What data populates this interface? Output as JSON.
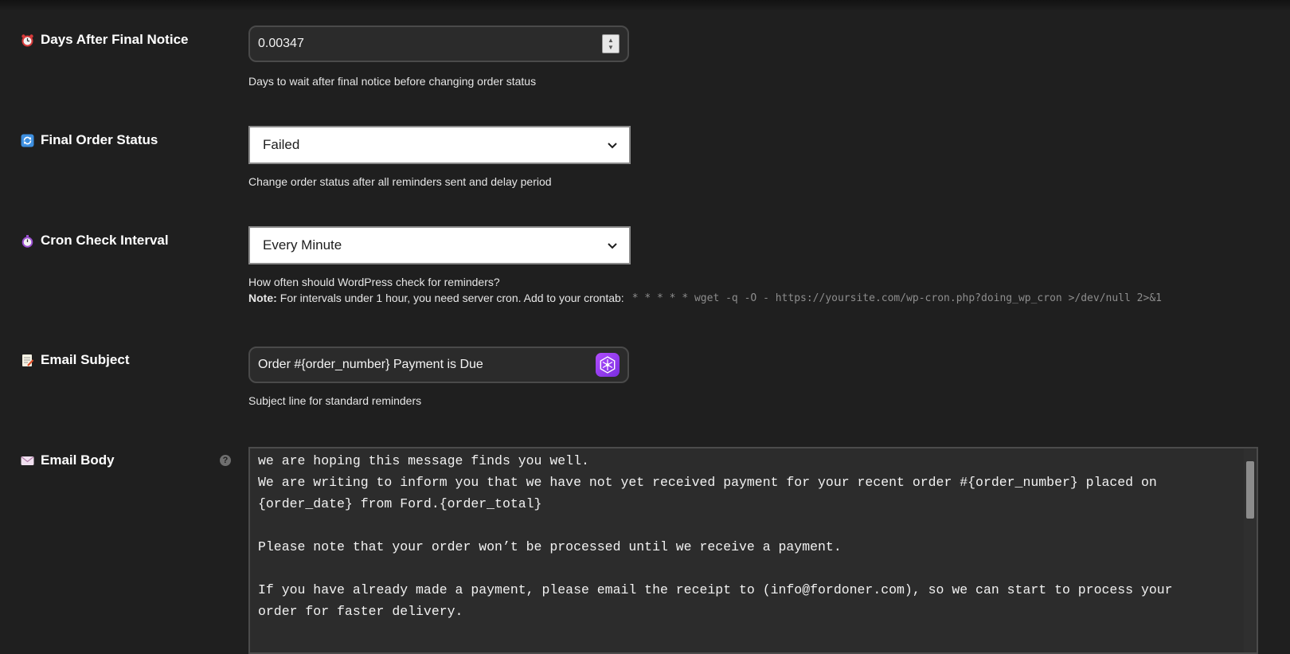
{
  "days_after_final_notice": {
    "label": "Days After Final Notice",
    "value": "0.00347",
    "description": "Days to wait after final notice before changing order status",
    "icon": "alarm-clock-icon"
  },
  "final_order_status": {
    "label": "Final Order Status",
    "selected": "Failed",
    "description": "Change order status after all reminders sent and delay period",
    "icon": "refresh-icon"
  },
  "cron_check_interval": {
    "label": "Cron Check Interval",
    "selected": "Every Minute",
    "description": "How often should WordPress check for reminders?",
    "note_label": "Note:",
    "note_text": "For intervals under 1 hour, you need server cron. Add to your crontab:",
    "cron_command": "* * * * * wget -q -O - https://yoursite.com/wp-cron.php?doing_wp_cron >/dev/null 2>&1",
    "icon": "stopwatch-icon"
  },
  "email_subject": {
    "label": "Email Subject",
    "value": "Order #{order_number} Payment is Due",
    "description": "Subject line for standard reminders",
    "icon": "memo-icon"
  },
  "email_body": {
    "label": "Email Body",
    "help": "?",
    "content": "we are hoping this message finds you well.\nWe are writing to inform you that we have not yet received payment for your recent order #{order_number} placed on\n{order_date} from Ford.{order_total}\n\nPlease note that your order won’t be processed until we receive a payment.\n\nIf you have already made a payment, please email the receipt to (info@fordoner.com), so we can start to process your\norder for faster delivery.",
    "icon": "envelope-icon"
  },
  "colors": {
    "background": "#1f1f1f",
    "input_dark": "#2b2b2b",
    "ai_accent": "#a040f0"
  }
}
